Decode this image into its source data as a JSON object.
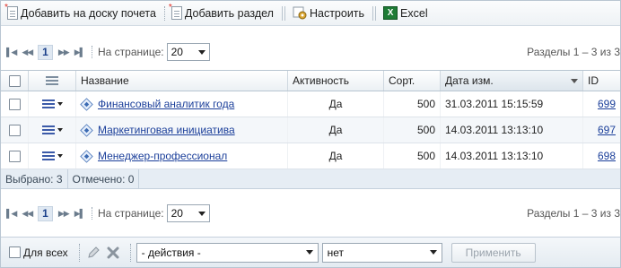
{
  "toolbar": {
    "add_favorites_label": "Добавить на доску почета",
    "add_section_label": "Добавить раздел",
    "settings_label": "Настроить",
    "excel_label": "Excel"
  },
  "pager": {
    "current_page": "1",
    "per_page_label": "На странице:",
    "per_page_value": "20",
    "range_text": "Разделы 1 – 3 из 3"
  },
  "grid": {
    "columns": {
      "name": "Название",
      "activity": "Активность",
      "sort": "Сорт.",
      "date": "Дата изм.",
      "id": "ID"
    },
    "rows": [
      {
        "name": "Финансовый аналитик года",
        "activity": "Да",
        "sort": "500",
        "date": "31.03.2011 15:15:59",
        "id": "699"
      },
      {
        "name": "Маркетинговая инициатива",
        "activity": "Да",
        "sort": "500",
        "date": "14.03.2011 13:13:10",
        "id": "697"
      },
      {
        "name": "Менеджер-профессионал",
        "activity": "Да",
        "sort": "500",
        "date": "14.03.2011 13:13:10",
        "id": "698"
      }
    ],
    "footer": {
      "selected": "Выбрано: 3",
      "checked": "Отмечено: 0"
    }
  },
  "actions": {
    "for_all_label": "Для всех",
    "action_select_value": "- действия -",
    "target_select_value": "нет",
    "apply_label": "Применить"
  },
  "colors": {
    "link": "#1b3f9a",
    "header_bg": "#ebf0f4",
    "footer_bg": "#e6edf4"
  }
}
